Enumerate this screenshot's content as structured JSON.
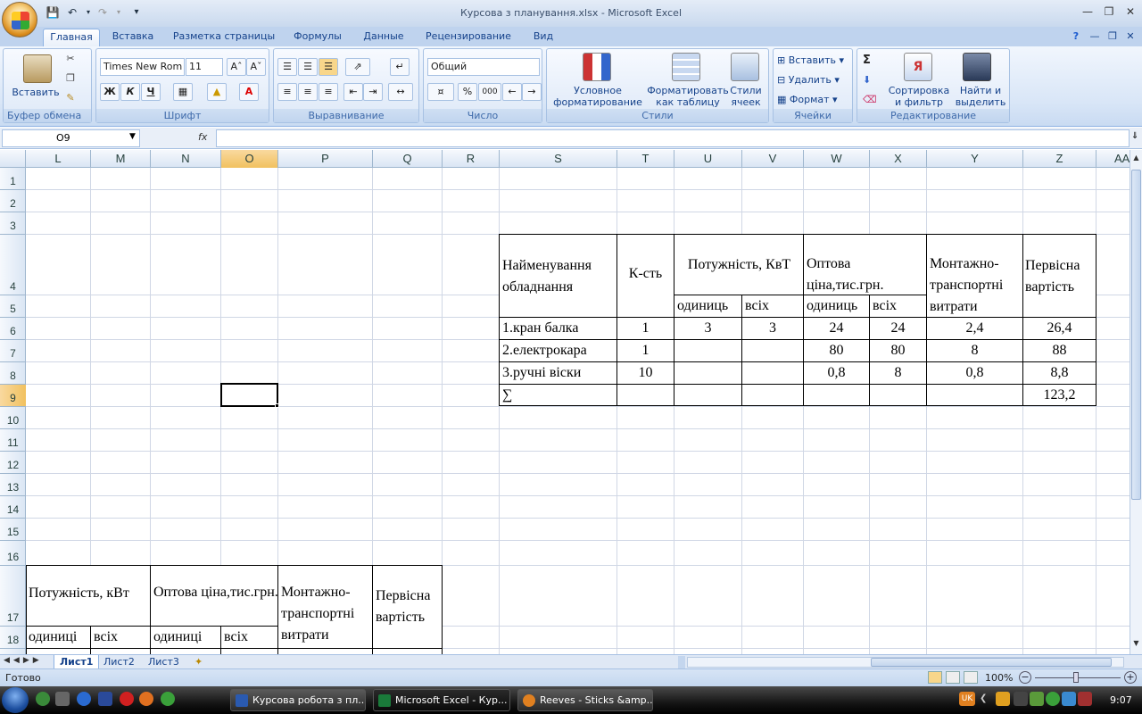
{
  "window": {
    "title": "Курсова з планування.xlsx - Microsoft Excel"
  },
  "tabs": [
    "Главная",
    "Вставка",
    "Разметка страницы",
    "Формулы",
    "Данные",
    "Рецензирование",
    "Вид"
  ],
  "ribbon": {
    "clipboard": {
      "label": "Буфер обмена",
      "paste": "Вставить"
    },
    "font": {
      "label": "Шрифт",
      "name": "Times New Rom",
      "size": "11",
      "bold": "Ж",
      "italic": "К",
      "underline": "Ч"
    },
    "alignment": {
      "label": "Выравнивание"
    },
    "number": {
      "label": "Число",
      "format": "Общий",
      "percent": "%",
      "thousands": "000"
    },
    "styles": {
      "label": "Стили",
      "cond_line1": "Условное",
      "cond_line2": "форматирование",
      "table_line1": "Форматировать",
      "table_line2": "как таблицу",
      "cell_line1": "Стили",
      "cell_line2": "ячеек"
    },
    "cells": {
      "label": "Ячейки",
      "insert": "Вставить",
      "delete": "Удалить",
      "format": "Формат"
    },
    "editing": {
      "label": "Редактирование",
      "sum": "Σ",
      "sort_line1": "Сортировка",
      "sort_line2": "и фильтр",
      "find_line1": "Найти и",
      "find_line2": "выделить"
    }
  },
  "formula_bar": {
    "name_box": "O9",
    "fx": "fx",
    "formula": ""
  },
  "columns": [
    "L",
    "M",
    "N",
    "O",
    "P",
    "Q",
    "R",
    "S",
    "T",
    "U",
    "V",
    "W",
    "X",
    "Y",
    "Z",
    "AA"
  ],
  "rows": [
    "1",
    "2",
    "3",
    "4",
    "5",
    "6",
    "7",
    "8",
    "9",
    "10",
    "11",
    "12",
    "13",
    "14",
    "15",
    "16",
    "17",
    "18"
  ],
  "table1": {
    "headers": {
      "name": "Найменування обладнання",
      "qty": "К-сть",
      "power": "Потужність, КвТ",
      "price": "Оптова ціна,тис.грн.",
      "mount": "Монтажно-транспортні витрати",
      "initial": "Первісна вартість",
      "unit": "одиниць",
      "all": "всіх",
      "unit2": "одиниць",
      "all2": "всіх"
    },
    "rows": [
      {
        "name": "1.кран балка",
        "qty": "1",
        "p_unit": "3",
        "p_all": "3",
        "c_unit": "24",
        "c_all": "24",
        "mount": "2,4",
        "initial": "26,4"
      },
      {
        "name": "2.електрокара",
        "qty": "1",
        "p_unit": "",
        "p_all": "",
        "c_unit": "80",
        "c_all": "80",
        "mount": "8",
        "initial": "88"
      },
      {
        "name": "3.ручні віски",
        "qty": "10",
        "p_unit": "",
        "p_all": "",
        "c_unit": "0,8",
        "c_all": "8",
        "mount": "0,8",
        "initial": "8,8"
      }
    ],
    "total": {
      "name": "∑",
      "initial": "123,2"
    }
  },
  "table2": {
    "power": "Потужність, кВт",
    "price": "Оптова ціна,тис.грн.",
    "mount": "Монтажно-транспортні витрати",
    "initial": "Первісна вартість",
    "unit": "одиниці",
    "all": "всіх",
    "unit2": "одиниці",
    "all2": "всіх"
  },
  "sheets": [
    "Лист1",
    "Лист2",
    "Лист3"
  ],
  "status": {
    "ready": "Готово",
    "zoom": "100%"
  },
  "taskbar": {
    "items": [
      "Курсова робота з пл...",
      "Microsoft Excel - Кур...",
      "Reeves - Sticks &amp..."
    ],
    "lang": "UK",
    "time": "9:07"
  }
}
